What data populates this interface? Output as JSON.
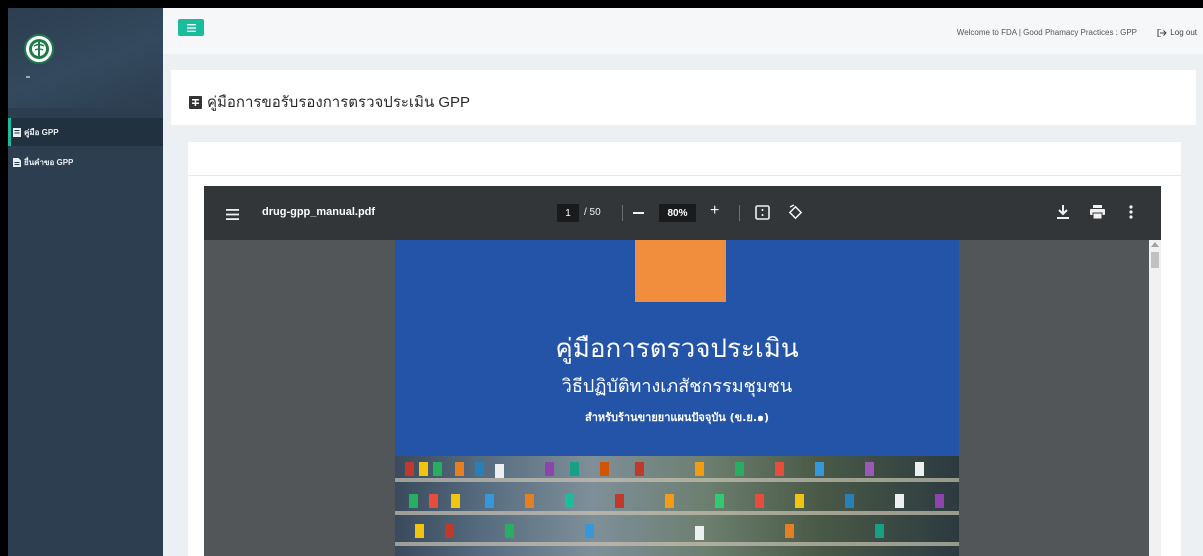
{
  "sidebar": {
    "user_name": "-",
    "items": [
      {
        "label": "คู่มือ GPP",
        "icon": "book-icon",
        "active": true
      },
      {
        "label": "ยื่นคำขอ GPP",
        "icon": "file-icon",
        "active": false
      }
    ]
  },
  "topbar": {
    "welcome": "Welcome to FDA | Good Phamacy Practices : GPP",
    "logout": "Log out"
  },
  "page": {
    "title": "คู่มือการขอรับรองการตรวจประเมิน GPP"
  },
  "pdf_viewer": {
    "filename": "drug-gpp_manual.pdf",
    "current_page": "1",
    "total_pages": "/ 50",
    "zoom": "80%"
  },
  "pdf_cover": {
    "title": "คู่มือการตรวจประเมิน",
    "subtitle": "วิธีปฏิบัติทางเภสัชกรรมชุมชน",
    "subtitle2": "สำหรับร้านขายยาแผนปัจจุบัน (ข.ย.๑)"
  },
  "colors": {
    "sidebar_bg": "#2c3e50",
    "accent": "#1abc9c",
    "viewer_toolbar": "#323639",
    "cover_blue": "#2354a8",
    "cover_orange": "#f18e3d"
  }
}
